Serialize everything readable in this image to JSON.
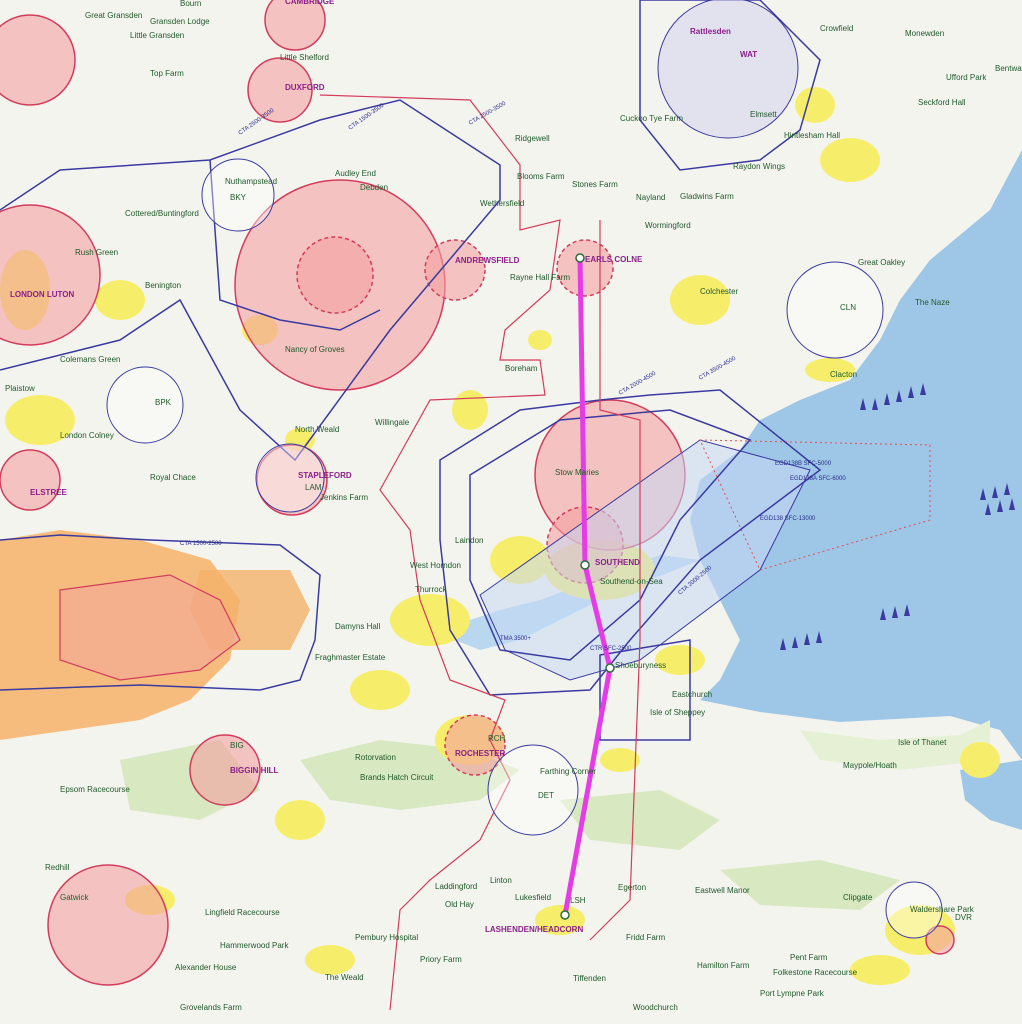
{
  "colors": {
    "land": "#f4f4ef",
    "sea": "#9ec6e6",
    "urban": "#f6ee6a",
    "forest": "#d8e8c0",
    "ctr_fill": "#f3a0a0",
    "ctr_stroke": "#d33c5c",
    "cta_stroke": "#3a3aa0",
    "danger_fill": "#c7d8f4",
    "route": "#e63ce6",
    "label_blue": "#2b2b8a",
    "label_magenta": "#8a1f8a",
    "london_tma": "#f4b26a"
  },
  "places": [
    {
      "name": "Bourn"
    },
    {
      "name": "Great Gransden"
    },
    {
      "name": "Gransden Lodge"
    },
    {
      "name": "Little Gransden"
    },
    {
      "name": "CAMBRIDGE"
    },
    {
      "name": "Little Shelford"
    },
    {
      "name": "DUXFORD"
    },
    {
      "name": "Top Farm"
    },
    {
      "name": "Audley End"
    },
    {
      "name": "Debden"
    },
    {
      "name": "Nuthampstead"
    },
    {
      "name": "BKY"
    },
    {
      "name": "Cottered/Buntingford"
    },
    {
      "name": "Benington"
    },
    {
      "name": "Rush Green"
    },
    {
      "name": "LONDON LUTON"
    },
    {
      "name": "ANDREWSFIELD"
    },
    {
      "name": "Rayne Hall Farm"
    },
    {
      "name": "EARLS COLNE"
    },
    {
      "name": "Wethersfield"
    },
    {
      "name": "Ridgewell"
    },
    {
      "name": "Blooms Farm"
    },
    {
      "name": "Stones Farm"
    },
    {
      "name": "Nayland"
    },
    {
      "name": "Gladwins Farm"
    },
    {
      "name": "Wormingford"
    },
    {
      "name": "Cuckoo Tye Farm"
    },
    {
      "name": "Rattlesden"
    },
    {
      "name": "Elmsett"
    },
    {
      "name": "WAT"
    },
    {
      "name": "Crowfield"
    },
    {
      "name": "Monewden"
    },
    {
      "name": "Bentwaters"
    },
    {
      "name": "Ufford Park"
    },
    {
      "name": "Seckford Hall"
    },
    {
      "name": "Hintlesham Hall"
    },
    {
      "name": "Raydon Wings"
    },
    {
      "name": "Great Oakley"
    },
    {
      "name": "CLN"
    },
    {
      "name": "The Naze"
    },
    {
      "name": "Clacton"
    },
    {
      "name": "Colchester"
    },
    {
      "name": "Boreham"
    },
    {
      "name": "Nancy of Groves"
    },
    {
      "name": "North Weald"
    },
    {
      "name": "Willingale"
    },
    {
      "name": "STAPLEFORD"
    },
    {
      "name": "LAM"
    },
    {
      "name": "Jenkins Farm"
    },
    {
      "name": "BPK"
    },
    {
      "name": "London Colney"
    },
    {
      "name": "ELSTREE"
    },
    {
      "name": "Colemans Green"
    },
    {
      "name": "Plaistow"
    },
    {
      "name": "Royal Chace"
    },
    {
      "name": "Stow Maries"
    },
    {
      "name": "Laindon"
    },
    {
      "name": "West Horndon"
    },
    {
      "name": "Thurrock"
    },
    {
      "name": "SOUTHEND"
    },
    {
      "name": "Southend-on-Sea"
    },
    {
      "name": "Damyns Hall"
    },
    {
      "name": "Fraghmaster Estate"
    },
    {
      "name": "Shoeburyness"
    },
    {
      "name": "Eastchurch"
    },
    {
      "name": "Isle of Sheppey"
    },
    {
      "name": "ROCHESTER"
    },
    {
      "name": "RCH"
    },
    {
      "name": "Farthing Corner"
    },
    {
      "name": "DET"
    },
    {
      "name": "BIGGIN HILL"
    },
    {
      "name": "BIG"
    },
    {
      "name": "Epsom Racecourse"
    },
    {
      "name": "Linton"
    },
    {
      "name": "Laddingford"
    },
    {
      "name": "Old Hay"
    },
    {
      "name": "Lukesfield"
    },
    {
      "name": "LASHENDEN/HEADCORN"
    },
    {
      "name": "LSH"
    },
    {
      "name": "Egerton"
    },
    {
      "name": "Fridd Farm"
    },
    {
      "name": "Hamilton Farm"
    },
    {
      "name": "Pent Farm"
    },
    {
      "name": "Tiffenden"
    },
    {
      "name": "Woodchurch"
    },
    {
      "name": "Lingfield Racecourse"
    },
    {
      "name": "Hammerwood Park"
    },
    {
      "name": "Alexander House"
    },
    {
      "name": "Grovelands Farm"
    },
    {
      "name": "Isle of Thanet"
    },
    {
      "name": "Maypole/Hoath"
    },
    {
      "name": "Clipgate"
    },
    {
      "name": "Waldershare Park"
    },
    {
      "name": "DVR"
    },
    {
      "name": "Eastwell Manor"
    },
    {
      "name": "Folkestone Racecourse"
    },
    {
      "name": "The Weald"
    },
    {
      "name": "Brands Hatch Circuit"
    },
    {
      "name": "Rotorvation"
    },
    {
      "name": "Gatwick"
    },
    {
      "name": "Redhill"
    },
    {
      "name": "Priory Farm"
    },
    {
      "name": "Pembury Hospital"
    },
    {
      "name": "Port Lympne Park"
    }
  ],
  "airspace_labels": [
    {
      "text": "CTA 2500-3500"
    },
    {
      "text": "CTA 1500-3500"
    },
    {
      "text": "CTA 2000-4500"
    },
    {
      "text": "CTA 3500-4500"
    },
    {
      "text": "CTA 1500-2500"
    },
    {
      "text": "CTA 2500-3500"
    },
    {
      "text": "EGD138A SFC-6000"
    },
    {
      "text": "EGD138B SFC-5000"
    },
    {
      "text": "EGD138 SFC-13000"
    },
    {
      "text": "TMA 3500+"
    },
    {
      "text": "CTA 2000-2500"
    },
    {
      "text": "CTR SFC-2500"
    }
  ],
  "route": {
    "label": "EARLS COLNE → SOUTHEND → LASHENDEN/HEADCORN"
  }
}
